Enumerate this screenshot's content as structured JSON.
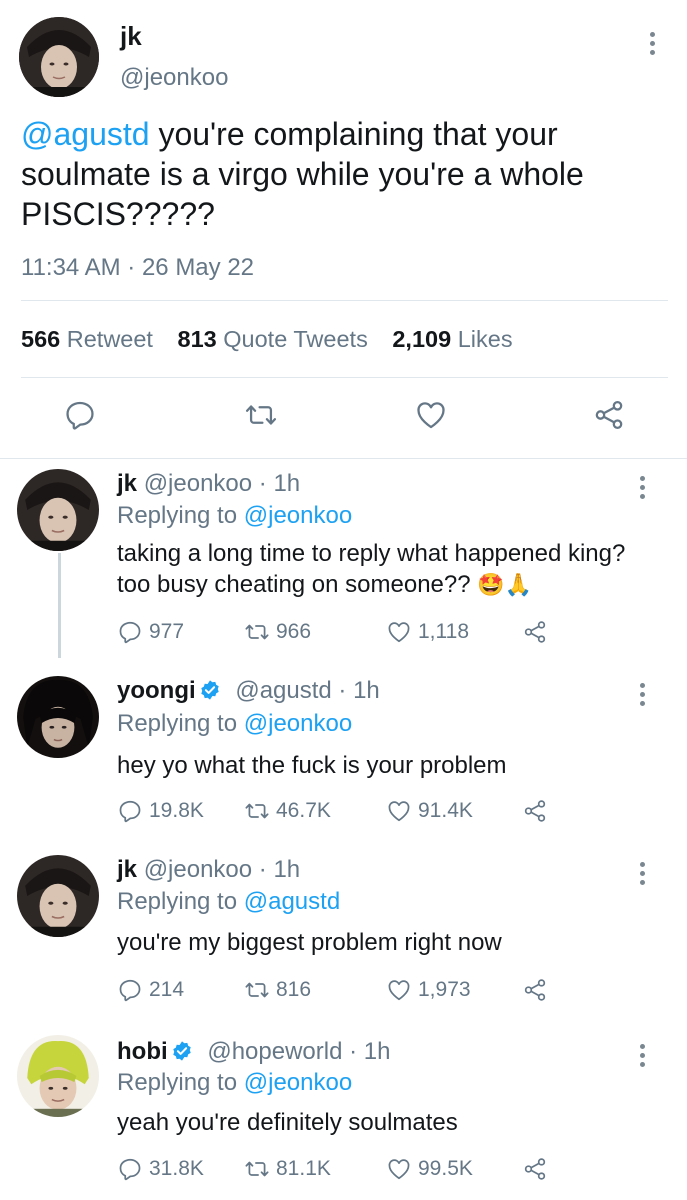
{
  "main_tweet": {
    "name": "jk",
    "handle": "@jeonkoo",
    "mention": "@agustd",
    "text": " you're complaining that your soulmate is a virgo while you're a whole PISCIS?????",
    "timestamp": "11:34 AM · 26 May 22",
    "stats": {
      "retweets_count": "566",
      "retweets_label": "Retweet",
      "quotes_count": "813",
      "quotes_label": "Quote Tweets",
      "likes_count": "2,109",
      "likes_label": "Likes"
    }
  },
  "replies": [
    {
      "name": "jk",
      "handle_time": "@jeonkoo · 1h",
      "replying_prefix": "Replying to ",
      "replying_to": "@jeonkoo",
      "text": "taking a long time to reply what happened king? too busy cheating on someone??",
      "emoji": "🤩🙏",
      "replies": "977",
      "retweets": "966",
      "likes": "1,118",
      "verified": false
    },
    {
      "name": "yoongi",
      "handle_time": "@agustd · 1h",
      "replying_prefix": "Replying to ",
      "replying_to": "@jeonkoo",
      "text": "hey yo what the fuck is your problem",
      "replies": "19.8K",
      "retweets": "46.7K",
      "likes": "91.4K",
      "verified": true
    },
    {
      "name": "jk",
      "handle_time": "@jeonkoo · 1h",
      "replying_prefix": "Replying to ",
      "replying_to": "@agustd",
      "text": "you're my biggest problem right now",
      "replies": "214",
      "retweets": "816",
      "likes": "1,973",
      "verified": false
    },
    {
      "name": "hobi",
      "handle_time": "@hopeworld · 1h",
      "replying_prefix": "Replying to ",
      "replying_to": "@jeonkoo",
      "text": "yeah you're definitely soulmates",
      "replies": "31.8K",
      "retweets": "81.1K",
      "likes": "99.5K",
      "verified": true
    }
  ],
  "colors": {
    "link_blue": "#1da1f2",
    "secondary_gray": "#657786",
    "divider": "#e1e8ed"
  },
  "icons": [
    "kebab-menu-icon",
    "reply-icon",
    "retweet-icon",
    "like-icon",
    "share-icon",
    "verified-badge-icon"
  ]
}
